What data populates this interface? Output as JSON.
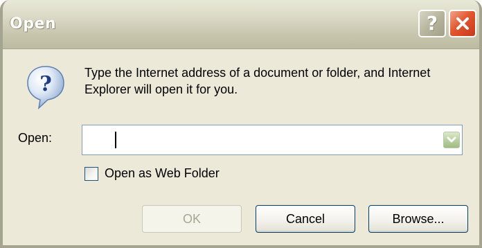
{
  "window": {
    "title": "Open"
  },
  "titlebar_buttons": {
    "help": "?",
    "close_icon": "close-icon"
  },
  "message": {
    "icon": "question-balloon-icon",
    "text": "Type the Internet address of a document or folder, and Internet Explorer will open it for you."
  },
  "open_field": {
    "label": "Open:",
    "value": "",
    "dropdown_icon": "chevron-down-icon"
  },
  "web_folder_option": {
    "label": "Open as Web Folder",
    "checked": false
  },
  "buttons": {
    "ok": "OK",
    "cancel": "Cancel",
    "browse": "Browse..."
  },
  "colors": {
    "titlebar": "#c8c6ae",
    "dialog_background": "#ece9d8",
    "close_button": "#e2572f",
    "dropdown_button": "#b9cfa0",
    "button_border": "#003c74"
  }
}
